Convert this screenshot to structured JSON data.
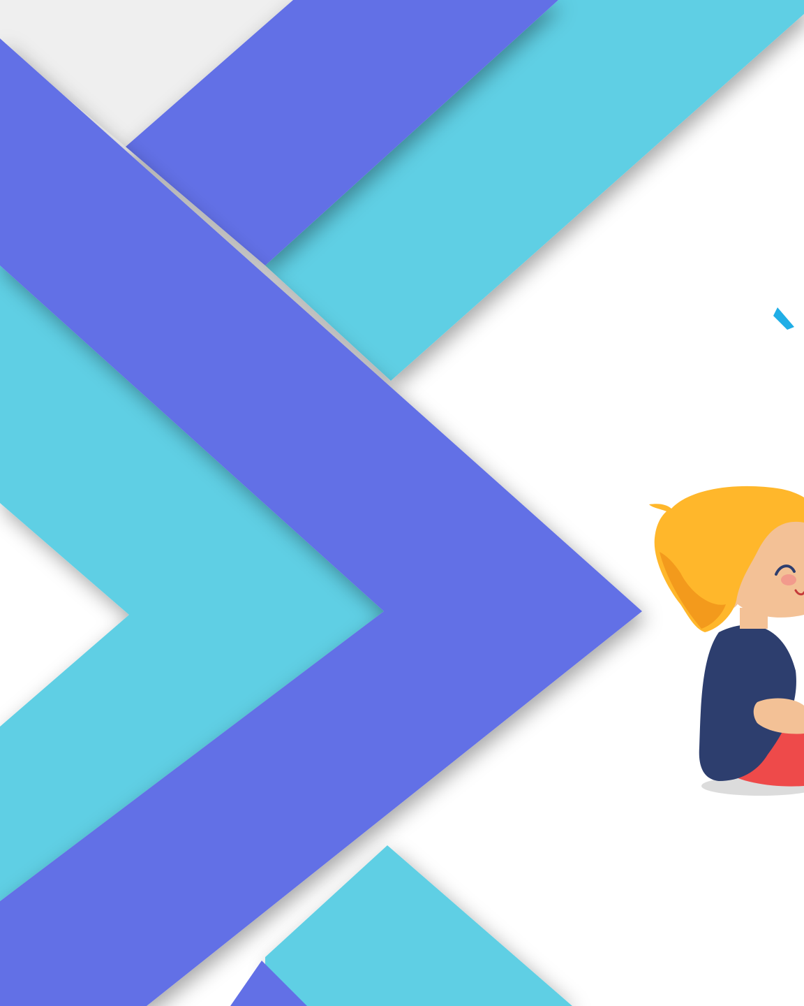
{
  "colors": {
    "background": "#ffffff",
    "stripe_cyan": "#5ecfe4",
    "stripe_cyan_shade": "#3fa8b8",
    "stripe_indigo": "#6270e6",
    "stripe_indigo_shade": "#4a55b8",
    "accent_tick": "#20aee6",
    "hair": "#ffb72b",
    "hair_shade": "#f39a1c",
    "skin": "#f3c196",
    "cheek": "#f29a8c",
    "shirt": "#2d3e6e",
    "pants": "#ee4a4a",
    "mouth": "#c43a3a",
    "shadow": "#dcdcdc"
  },
  "illustration": {
    "subject": "smiling-boy-sitting",
    "background_pattern": "overlapping-chevron-stripes"
  }
}
